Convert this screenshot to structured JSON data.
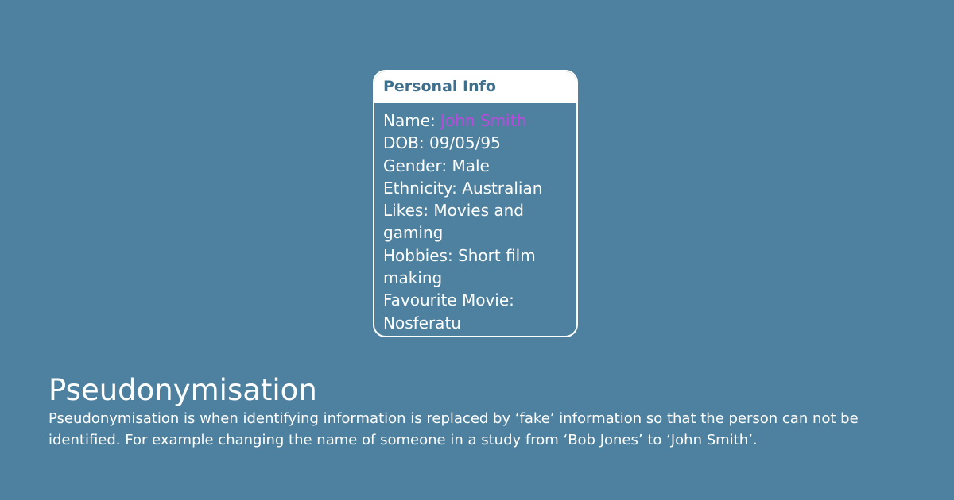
{
  "colors": {
    "background": "#4e819f",
    "card_border": "#ffffff",
    "card_header_text": "#3e6f8d",
    "body_text": "#ffffff",
    "name_highlight": "#b64bdc"
  },
  "card": {
    "title": "Personal Info",
    "fields": [
      {
        "label": "Name: ",
        "value": "John Smith"
      },
      {
        "label": "DOB: ",
        "value": "09/05/95"
      },
      {
        "label": "Gender: ",
        "value": "Male"
      },
      {
        "label": "Ethnicity: ",
        "value": "Australian"
      },
      {
        "label": "Likes: ",
        "value": "Movies and"
      },
      {
        "label": "",
        "value": "gaming"
      },
      {
        "label": "Hobbies: ",
        "value": "Short film"
      },
      {
        "label": "",
        "value": "making"
      },
      {
        "label": "Favourite Movie:",
        "value": ""
      },
      {
        "label": "",
        "value": "Nosferatu"
      }
    ]
  },
  "section": {
    "title": "Pseudonymisation",
    "description": "Pseudonymisation is when identifying information is replaced by  ‘fake’ information so that the person can not be identified. For example changing the name of someone in a study from ‘Bob Jones’ to ‘John Smith’."
  }
}
